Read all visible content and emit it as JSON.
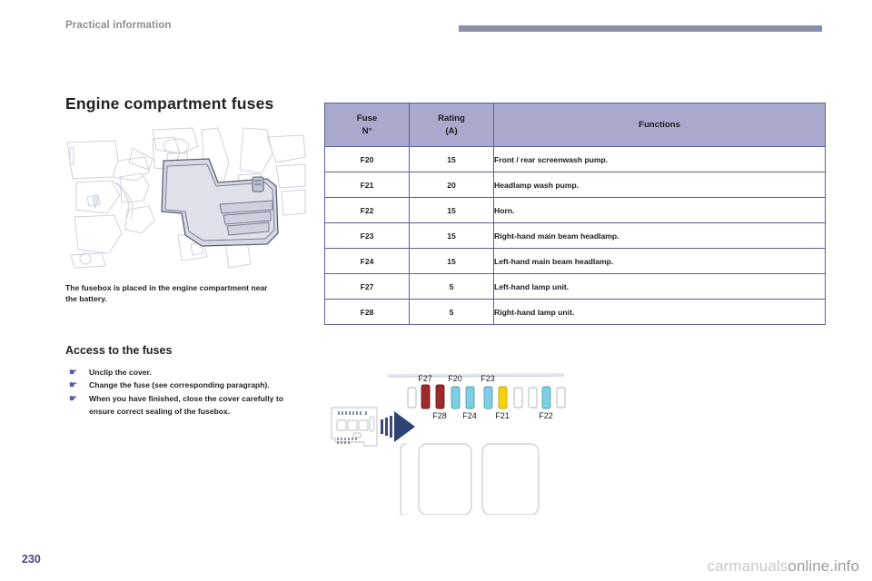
{
  "header": {
    "chapter": "Practical information"
  },
  "left": {
    "section_title": "Engine compartment fuses",
    "fusebox_caption": "The fusebox is placed in the engine compartment near the battery.",
    "access_title": "Access to the fuses",
    "bullets": [
      "Unclip the cover.",
      "Change the fuse (see corresponding paragraph).",
      "When you have finished, close the cover carefully to ensure correct sealing of the fusebox."
    ],
    "bullet_marker": "pointer-icon"
  },
  "table": {
    "headers": {
      "fuse": "Fuse",
      "fuse_sub": "N°",
      "rating": "Rating",
      "rating_sub": "(A)",
      "functions": "Functions"
    },
    "rows": [
      {
        "fuse": "F20",
        "rating": "15",
        "functions": "Front / rear screenwash pump."
      },
      {
        "fuse": "F21",
        "rating": "20",
        "functions": "Headlamp wash pump."
      },
      {
        "fuse": "F22",
        "rating": "15",
        "functions": "Horn."
      },
      {
        "fuse": "F23",
        "rating": "15",
        "functions": "Right-hand main beam headlamp."
      },
      {
        "fuse": "F24",
        "rating": "15",
        "functions": "Left-hand main beam headlamp."
      },
      {
        "fuse": "F27",
        "rating": "5",
        "functions": "Left-hand lamp unit."
      },
      {
        "fuse": "F28",
        "rating": "5",
        "functions": "Right-hand lamp unit."
      }
    ]
  },
  "diagram": {
    "labels_top": [
      "F27",
      "F20",
      "F23"
    ],
    "labels_bottom": [
      "F28",
      "F24",
      "F21",
      "F22"
    ],
    "fuse_colors": [
      "#ffffff",
      "#9e2b2b",
      "#9e2b2b",
      "#7ecfe4",
      "#7ecfe4",
      "#7ecfe4",
      "#f5d20c",
      "#ffffff",
      "#ffffff",
      "#7ecfe4",
      "#ffffff"
    ],
    "arrow_color": "#2d4373"
  },
  "footer": {
    "page_number": "230",
    "watermark_light": "carmanuals",
    "watermark_dark": "online.info"
  },
  "colors": {
    "header_band": "#8c8fa8",
    "table_header_bg": "#a8a9cd",
    "table_border": "#5d5f96",
    "accent_text": "#474a73",
    "chapter_text": "#8e8e8e"
  }
}
